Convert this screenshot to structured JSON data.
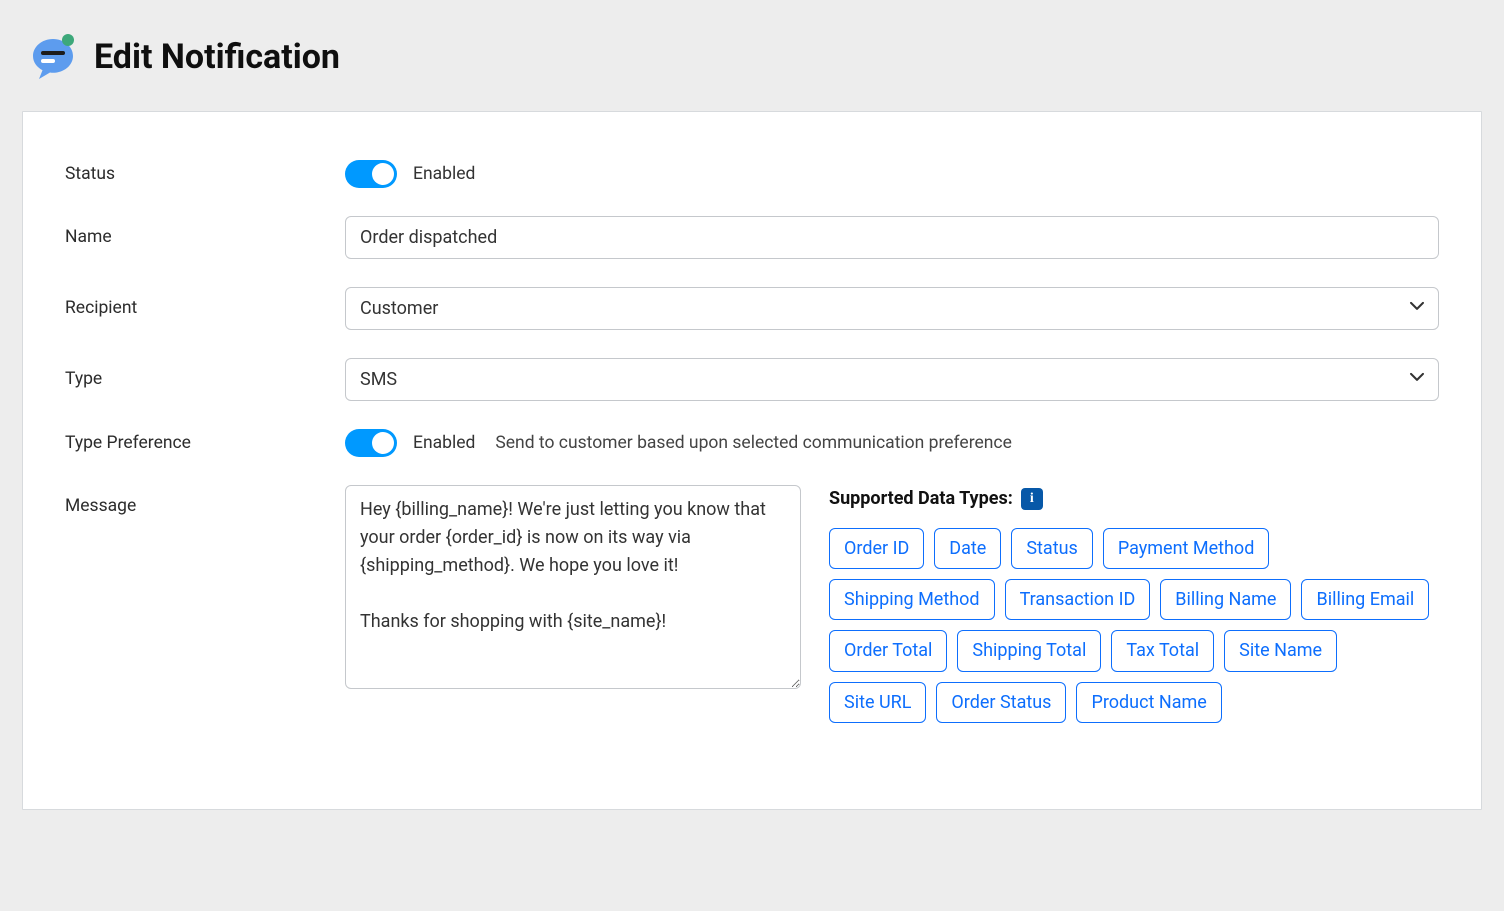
{
  "pageTitle": "Edit Notification",
  "labels": {
    "status": "Status",
    "name": "Name",
    "recipient": "Recipient",
    "type": "Type",
    "typePreference": "Type Preference",
    "message": "Message"
  },
  "statusToggle": {
    "text": "Enabled"
  },
  "nameField": {
    "value": "Order dispatched"
  },
  "recipientField": {
    "value": "Customer"
  },
  "typeField": {
    "value": "SMS"
  },
  "typePreference": {
    "text": "Enabled",
    "hint": "Send to customer based upon selected communication preference"
  },
  "messageField": {
    "value": "Hey {billing_name}! We're just letting you know that your order {order_id} is now on its way via {shipping_method}. We hope you love it!\n\nThanks for shopping with {site_name}!"
  },
  "dataTypesTitle": "Supported Data Types:",
  "tags": [
    "Order ID",
    "Date",
    "Status",
    "Payment Method",
    "Shipping Method",
    "Transaction ID",
    "Billing Name",
    "Billing Email",
    "Order Total",
    "Shipping Total",
    "Tax Total",
    "Site Name",
    "Site URL",
    "Order Status",
    "Product Name"
  ]
}
